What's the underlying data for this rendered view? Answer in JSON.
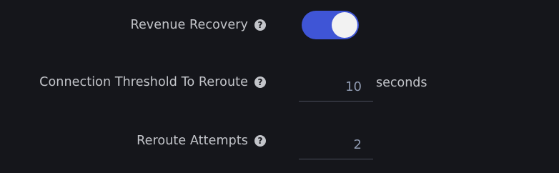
{
  "settings": {
    "revenue_recovery": {
      "label": "Revenue Recovery",
      "help_icon": "question-circle-icon",
      "enabled": true
    },
    "connection_threshold": {
      "label": "Connection Threshold To Reroute",
      "help_icon": "question-circle-icon",
      "value": "10",
      "unit": "seconds"
    },
    "reroute_attempts": {
      "label": "Reroute Attempts",
      "help_icon": "question-circle-icon",
      "value": "2"
    }
  },
  "colors": {
    "background": "#15161b",
    "toggle_on": "#3f55d6",
    "label_text": "#c3c5ca",
    "input_text": "#8f9ab0"
  }
}
